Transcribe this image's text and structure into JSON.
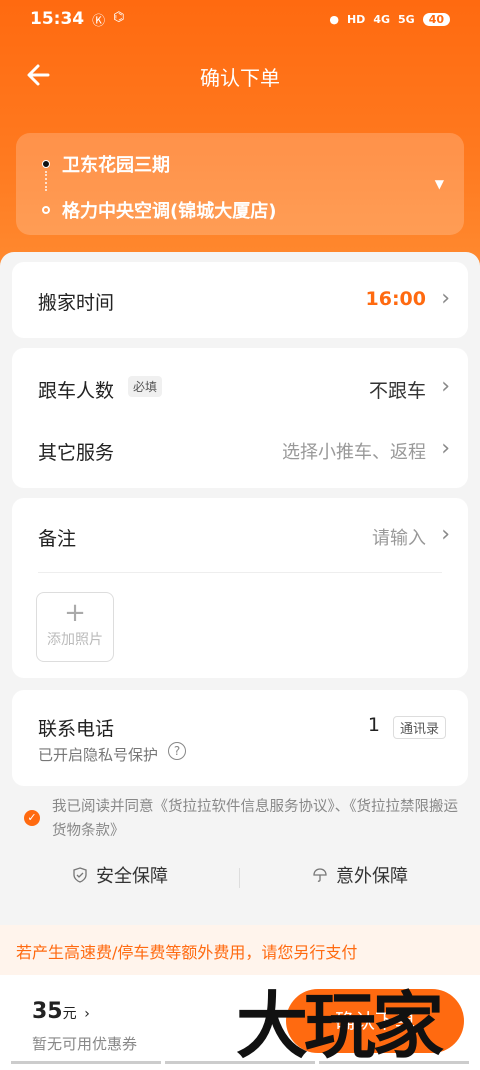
{
  "status_bar": {
    "time": "15:34",
    "left_icons": [
      "Ⓚ",
      "⌬"
    ],
    "right_icons": [
      "HD",
      "4G",
      "5G"
    ],
    "battery": "40"
  },
  "nav": {
    "title": "确认下单"
  },
  "address": {
    "start": "卫东花园三期",
    "end": "格力中央空调(锦城大厦店)"
  },
  "moving_time": {
    "label": "搬家时间",
    "value": "16:00"
  },
  "companion": {
    "label": "跟车人数",
    "badge": "必填",
    "value": "不跟车"
  },
  "other_services": {
    "label": "其它服务",
    "hint": "选择小推车、返程"
  },
  "remarks": {
    "label": "备注",
    "hint": "请输入",
    "add_photo": "添加照片"
  },
  "contact": {
    "label": "联系电话",
    "privacy": "已开启隐私号保护",
    "phone_value": "1",
    "contacts_button": "通讯录"
  },
  "agreement": {
    "text": "我已阅读并同意《货拉拉软件信息服务协议》、《货拉拉禁限搬运货物条款》"
  },
  "guarantees": {
    "safety": "安全保障",
    "accident": "意外保障"
  },
  "notice": "若产生高速费/停车费等额外费用，请您另行支付",
  "footer": {
    "price": "35",
    "price_unit": "元",
    "coupon": "暂无可用优惠券",
    "confirm": "确认下单"
  },
  "watermark": "大玩家",
  "colors": {
    "accent": "#ff6a10",
    "time_value": "#ff6a10"
  }
}
